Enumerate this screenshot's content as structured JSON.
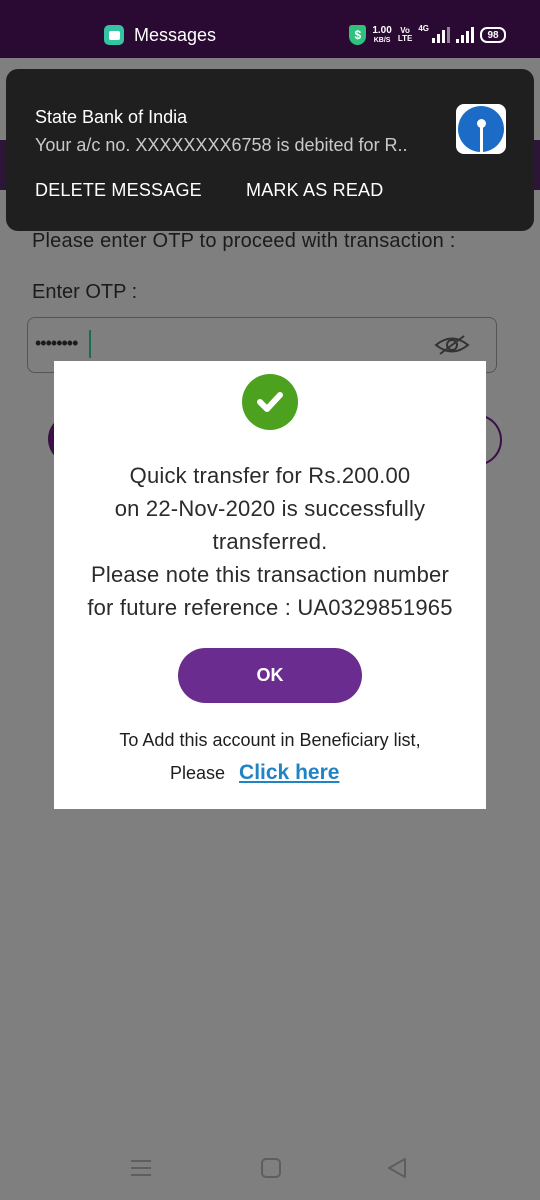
{
  "status_bar": {
    "app_name": "Messages",
    "speed_value": "1.00",
    "speed_unit": "KB/S",
    "volte_top": "Vo",
    "volte_bottom": "LTE",
    "network": "4G",
    "battery": "98",
    "shield_icon": "dollar-shield-icon"
  },
  "notification": {
    "sender": "State Bank of India",
    "preview": "Your a/c no. XXXXXXXX6758 is debited for R..",
    "actions": {
      "delete": "DELETE MESSAGE",
      "mark_read": "MARK AS READ"
    },
    "logo_icon": "sbi-logo-icon"
  },
  "background_app": {
    "prompt": "Please enter OTP to proceed with transaction :",
    "otp_label": "Enter OTP :",
    "otp_value": "••••••••"
  },
  "dialog": {
    "message_lines": [
      "Quick transfer for Rs.200.00",
      "on 22-Nov-2020 is successfully",
      "transferred.",
      "Please note this transaction number",
      "for future reference : UA0329851965"
    ],
    "ok_label": "OK",
    "add_note": "To Add this account in Beneficiary list,",
    "please": "Please",
    "link_label": "Click here",
    "colors": {
      "success": "#4ca21e",
      "button": "#6a2c8e",
      "link": "#1f84c6"
    }
  },
  "nav_bar": {
    "icons": [
      "menu-icon",
      "home-icon",
      "back-icon"
    ]
  }
}
